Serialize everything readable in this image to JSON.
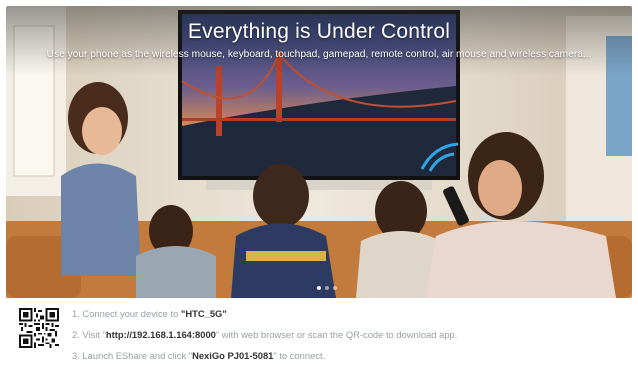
{
  "banner": {
    "title": "Everything is Under Control",
    "subtitle": "Use your phone as the wireless mouse, keyboard, touchpad, gamepad, remote control, air mouse and wireless camera...",
    "pager": {
      "count": 3,
      "active_index": 0
    }
  },
  "instructions": {
    "step1": {
      "prefix": "1. Connect your device to ",
      "value": "\"HTC_5G\""
    },
    "step2": {
      "prefix": "2. Visit \"",
      "value": "http://192.168.1.164:8000",
      "suffix": "\" with web browser or scan the QR-code to download app."
    },
    "step3": {
      "prefix": "3. Launch EShare and click \"",
      "value": "NexiGo PJ01-5081",
      "suffix": "\" to connect."
    }
  },
  "qr_code": {
    "icon": "qr-code-icon"
  }
}
